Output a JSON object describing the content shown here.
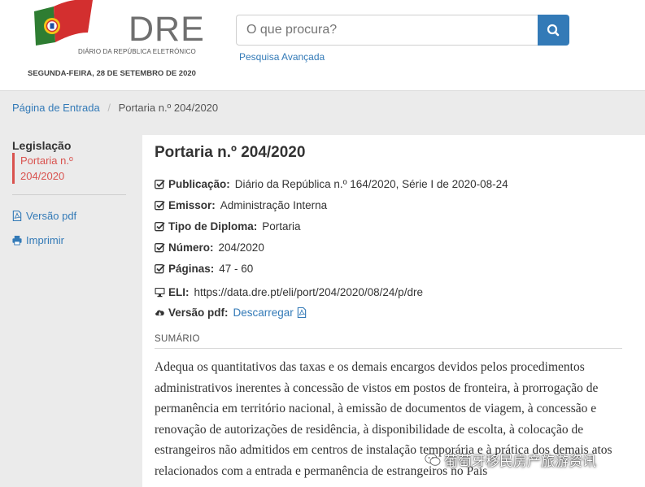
{
  "header": {
    "logo_text": "DRE",
    "logo_subtitle": "DIÁRIO DA REPÚBLICA ELETRÓNICO",
    "date": "SEGUNDA-FEIRA, 28 DE SETEMBRO DE 2020",
    "search_placeholder": "O que procura?",
    "advanced_search": "Pesquisa Avançada",
    "colors": {
      "green": "#2e7d32",
      "red": "#d32f2f",
      "blue": "#337ab7"
    }
  },
  "breadcrumb": {
    "home": "Página de Entrada",
    "separator": "/",
    "current": "Portaria n.º 204/2020"
  },
  "sidebar": {
    "title": "Legislação",
    "active_line1": "Portaria n.º",
    "active_line2": "204/2020",
    "pdf_link": "Versão pdf",
    "print_link": "Imprimir"
  },
  "document": {
    "title": "Portaria n.º 204/2020",
    "publicacao_label": "Publicação:",
    "publicacao_value": "Diário da República n.º 164/2020, Série I de 2020-08-24",
    "emissor_label": "Emissor:",
    "emissor_value": "Administração Interna",
    "tipo_label": "Tipo de Diploma:",
    "tipo_value": "Portaria",
    "numero_label": "Número:",
    "numero_value": "204/2020",
    "paginas_label": "Páginas:",
    "paginas_value": "47 - 60",
    "eli_label": "ELI:",
    "eli_value": "https://data.dre.pt/eli/port/204/2020/08/24/p/dre",
    "pdf_label": "Versão pdf:",
    "pdf_link": "Descarregar",
    "summary_label": "SUMÁRIO",
    "summary_text": "Adequa os quantitativos das taxas e os demais encargos devidos pelos procedimentos administrativos inerentes à concessão de vistos em postos de fronteira, à prorrogação de permanência em território nacional, à emissão de documentos de viagem, à concessão e renovação de autorizações de residência, à disponibilidade de escolta, à colocação de estrangeiros não admitidos em centros de instalação temporária e à prática dos demais atos relacionados com a entrada e permanência de estrangeiros no País"
  },
  "watermark": "葡萄牙移民房产旅游资讯"
}
